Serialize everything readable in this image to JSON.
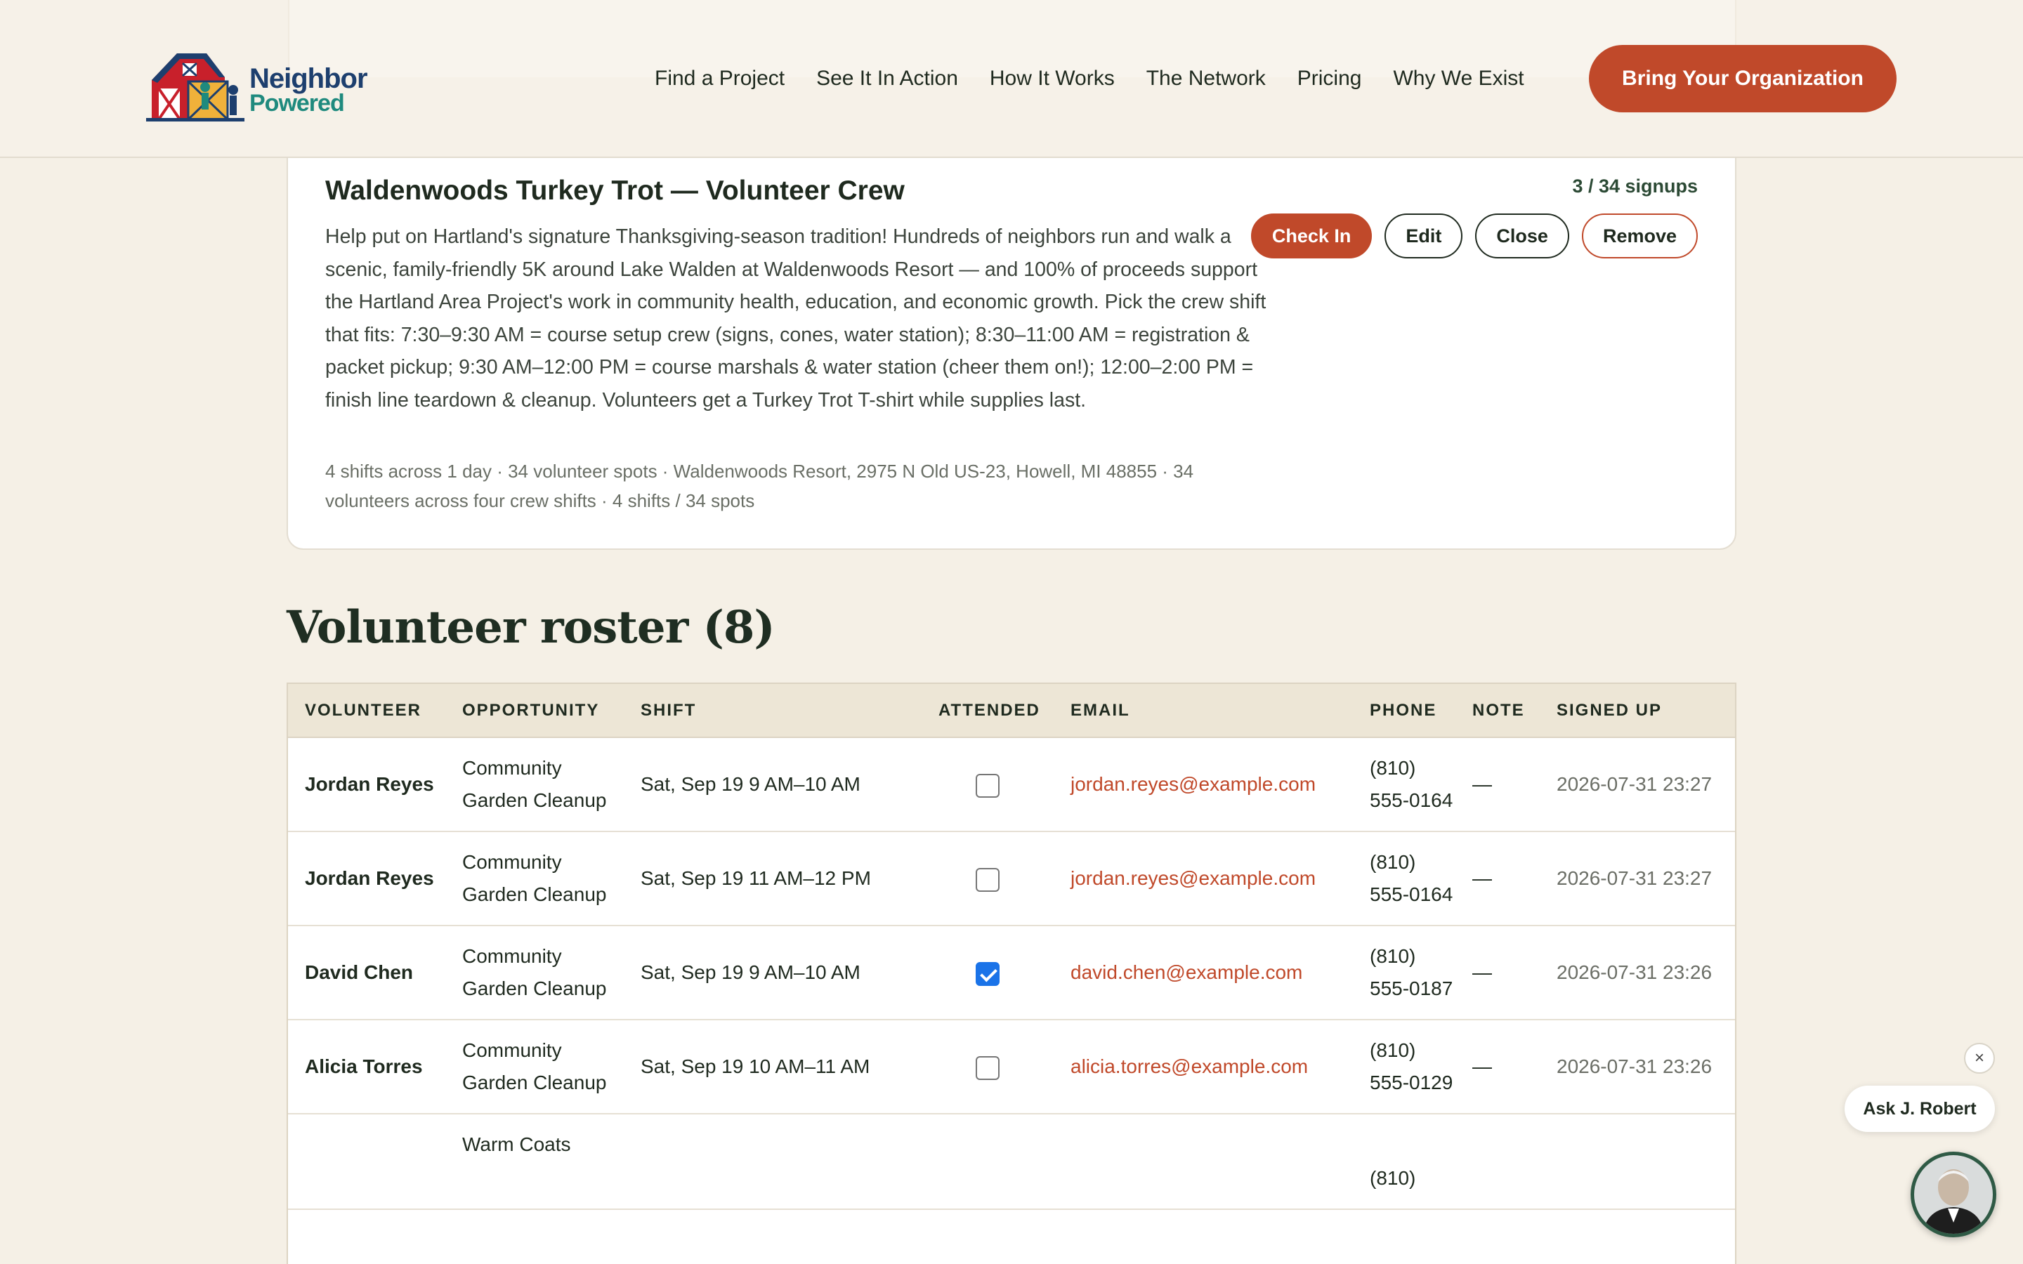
{
  "header": {
    "logo_line1": "Neighbor",
    "logo_line2": "Powered",
    "nav": [
      "Find a Project",
      "See It In Action",
      "How It Works",
      "The Network",
      "Pricing",
      "Why We Exist"
    ],
    "cta": "Bring Your Organization"
  },
  "opportunity": {
    "title": "Waldenwoods Turkey Trot — Volunteer Crew",
    "signups": "3 / 34 signups",
    "description": "Help put on Hartland's signature Thanksgiving-season tradition! Hundreds of neighbors run and walk a scenic, family-friendly 5K around Lake Walden at Waldenwoods Resort — and 100% of proceeds support the Hartland Area Project's work in community health, education, and economic growth. Pick the crew shift that fits: 7:30–9:30 AM = course setup crew (signs, cones, water station); 8:30–11:00 AM = registration & packet pickup; 9:30 AM–12:00 PM = course marshals & water station (cheer them on!); 12:00–2:00 PM = finish line teardown & cleanup. Volunteers get a Turkey Trot T-shirt while supplies last.",
    "meta": "4 shifts across 1 day · 34 volunteer spots · Waldenwoods Resort, 2975 N Old US-23, Howell, MI 48855 · 34 volunteers across four crew shifts · 4 shifts / 34 spots",
    "actions": {
      "check_in": "Check In",
      "edit": "Edit",
      "close": "Close",
      "remove": "Remove"
    }
  },
  "roster": {
    "title": "Volunteer roster (8)",
    "columns": [
      "VOLUNTEER",
      "OPPORTUNITY",
      "SHIFT",
      "ATTENDED",
      "EMAIL",
      "PHONE",
      "NOTE",
      "SIGNED UP"
    ],
    "rows": [
      {
        "volunteer": "Jordan Reyes",
        "opportunity": "Community Garden Cleanup",
        "shift": "Sat, Sep 19 9 AM–10 AM",
        "attended": false,
        "email": "jordan.reyes@example.com",
        "phone": "(810) 555-0164",
        "note": "—",
        "signed_up": "2026-07-31 23:27"
      },
      {
        "volunteer": "Jordan Reyes",
        "opportunity": "Community Garden Cleanup",
        "shift": "Sat, Sep 19 11 AM–12 PM",
        "attended": false,
        "email": "jordan.reyes@example.com",
        "phone": "(810) 555-0164",
        "note": "—",
        "signed_up": "2026-07-31 23:27"
      },
      {
        "volunteer": "David Chen",
        "opportunity": "Community Garden Cleanup",
        "shift": "Sat, Sep 19 9 AM–10 AM",
        "attended": true,
        "email": "david.chen@example.com",
        "phone": "(810) 555-0187",
        "note": "—",
        "signed_up": "2026-07-31 23:26"
      },
      {
        "volunteer": "Alicia Torres",
        "opportunity": "Community Garden Cleanup",
        "shift": "Sat, Sep 19 10 AM–11 AM",
        "attended": false,
        "email": "alicia.torres@example.com",
        "phone": "(810) 555-0129",
        "note": "—",
        "signed_up": "2026-07-31 23:26"
      },
      {
        "volunteer": "",
        "opportunity": "Warm Coats",
        "shift": "",
        "attended": null,
        "email": "",
        "phone": "(810)",
        "note": "",
        "signed_up": ""
      }
    ]
  },
  "chat": {
    "label": "Ask J. Robert",
    "close_icon": "×"
  },
  "colors": {
    "accent": "#c0492a",
    "background": "#f5f0e6",
    "header_row": "#ede6d6",
    "checkbox_on": "#1a73e8"
  }
}
